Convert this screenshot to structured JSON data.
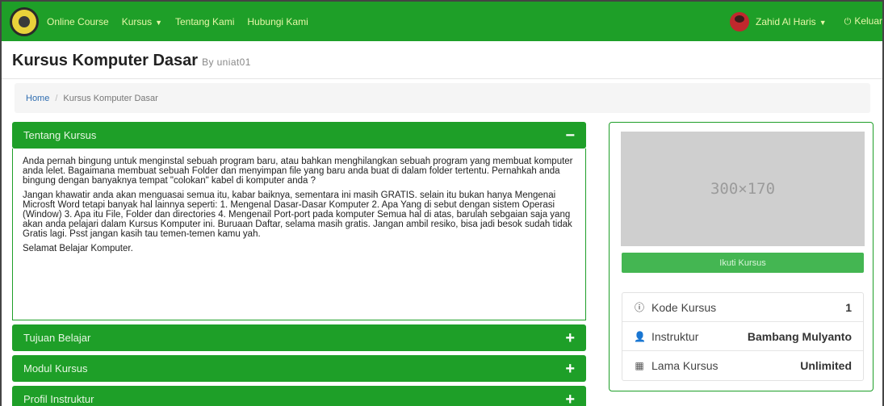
{
  "navbar": {
    "brand": "Online Course",
    "items": [
      {
        "label": "Kursus",
        "has_dropdown": true
      },
      {
        "label": "Tentang Kami",
        "has_dropdown": false
      },
      {
        "label": "Hubungi Kami",
        "has_dropdown": false
      }
    ],
    "user": "Zahid Al Haris",
    "logout": "Keluar",
    "colors": {
      "bar": "#1e9f28",
      "link": "#e6f7a8"
    }
  },
  "header": {
    "title": "Kursus Komputer Dasar",
    "by": "By uniat01"
  },
  "breadcrumb": {
    "home": "Home",
    "separator": "/",
    "current": "Kursus Komputer Dasar"
  },
  "accordion": {
    "panels": [
      {
        "title": "Tentang Kursus",
        "toggle": "−",
        "expanded": true
      },
      {
        "title": "Tujuan Belajar",
        "toggle": "+",
        "expanded": false
      },
      {
        "title": "Modul Kursus",
        "toggle": "+",
        "expanded": false
      },
      {
        "title": "Profil Instruktur",
        "toggle": "+",
        "expanded": false
      }
    ],
    "about_paragraphs": [
      "Anda pernah bingung untuk menginstal sebuah program baru, atau bahkan menghilangkan sebuah program yang membuat komputer anda lelet. Bagaimana membuat sebuah Folder dan menyimpan file yang baru anda buat di dalam folder tertentu. Pernahkah anda bingung dengan banyaknya tempat \"colokan\" kabel di komputer anda ?",
      "Jangan khawatir anda akan menguasai semua itu, kabar baiknya, sementara ini masih GRATIS. selain itu bukan hanya Mengenai Microsft Word tetapi banyak hal lainnya seperti: 1. Mengenal Dasar-Dasar Komputer 2. Apa Yang di sebut dengan sistem Operasi (Window) 3. Apa itu File, Folder dan directories 4. Mengenail Port-port pada komputer Semua hal di atas, barulah sebgaian saja yang akan anda pelajari dalam Kursus Komputer ini. Buruaan Daftar, selama masih gratis. Jangan ambil resiko, bisa jadi besok sudah tidak Gratis lagi. Psst jangan kasih tau temen-temen kamu yah.",
      "Selamat Belajar Komputer."
    ]
  },
  "sidebar": {
    "thumbnail_text": "300×170",
    "enroll_label": "Ikuti Kursus",
    "info": [
      {
        "icon": "info-circle-icon",
        "label": "Kode Kursus",
        "value": "1"
      },
      {
        "icon": "user-icon",
        "label": "Instruktur",
        "value": "Bambang Mulyanto"
      },
      {
        "icon": "calendar-icon",
        "label": "Lama Kursus",
        "value": "Unlimited"
      }
    ]
  }
}
